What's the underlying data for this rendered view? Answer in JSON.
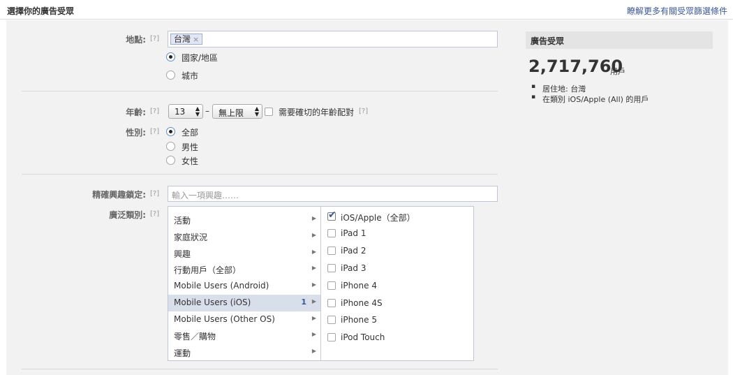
{
  "header": {
    "title": "選擇你的廣告受眾",
    "learn_more_link": "瞭解更多有關受眾篩選條件"
  },
  "form": {
    "help_label": "[?]",
    "location": {
      "label": "地點:",
      "token": "台灣",
      "token_remove": "×",
      "options": [
        "國家/地區",
        "城市"
      ],
      "selected": "國家/地區"
    },
    "age": {
      "label": "年齡:",
      "min": "13",
      "separator": "–",
      "max": "無上限",
      "exact_match_label": "需要確切的年齡配對",
      "exact_match_checked": false
    },
    "gender": {
      "label": "性別:",
      "options": [
        "全部",
        "男性",
        "女性"
      ],
      "selected": "全部"
    },
    "precise_interests": {
      "label": "精確興趣鎖定:",
      "placeholder": "輸入一項興趣……"
    },
    "broad_categories": {
      "label": "廣泛類別:",
      "categories": [
        {
          "name": "活動",
          "count": ""
        },
        {
          "name": "家庭狀況",
          "count": ""
        },
        {
          "name": "興趣",
          "count": ""
        },
        {
          "name": "行動用戶（全部）",
          "count": ""
        },
        {
          "name": "Mobile Users (Android)",
          "count": ""
        },
        {
          "name": "Mobile Users (iOS)",
          "count": "1"
        },
        {
          "name": "Mobile Users (Other OS)",
          "count": ""
        },
        {
          "name": "零售／購物",
          "count": ""
        },
        {
          "name": "運動",
          "count": ""
        }
      ],
      "selected_category": "Mobile Users (iOS)",
      "subcategories": [
        {
          "name": "iOS/Apple（全部）",
          "checked": true
        },
        {
          "name": "iPad 1",
          "checked": false
        },
        {
          "name": "iPad 2",
          "checked": false
        },
        {
          "name": "iPad 3",
          "checked": false
        },
        {
          "name": "iPhone 4",
          "checked": false
        },
        {
          "name": "iPhone 4S",
          "checked": false
        },
        {
          "name": "iPhone 5",
          "checked": false
        },
        {
          "name": "iPod Touch",
          "checked": false
        }
      ]
    }
  },
  "audience": {
    "heading": "廣告受眾",
    "count": "2,717,760",
    "unit": "用戶",
    "criteria": [
      "居住地: 台灣",
      "在類別 iOS/Apple (All) 的用戶"
    ]
  }
}
